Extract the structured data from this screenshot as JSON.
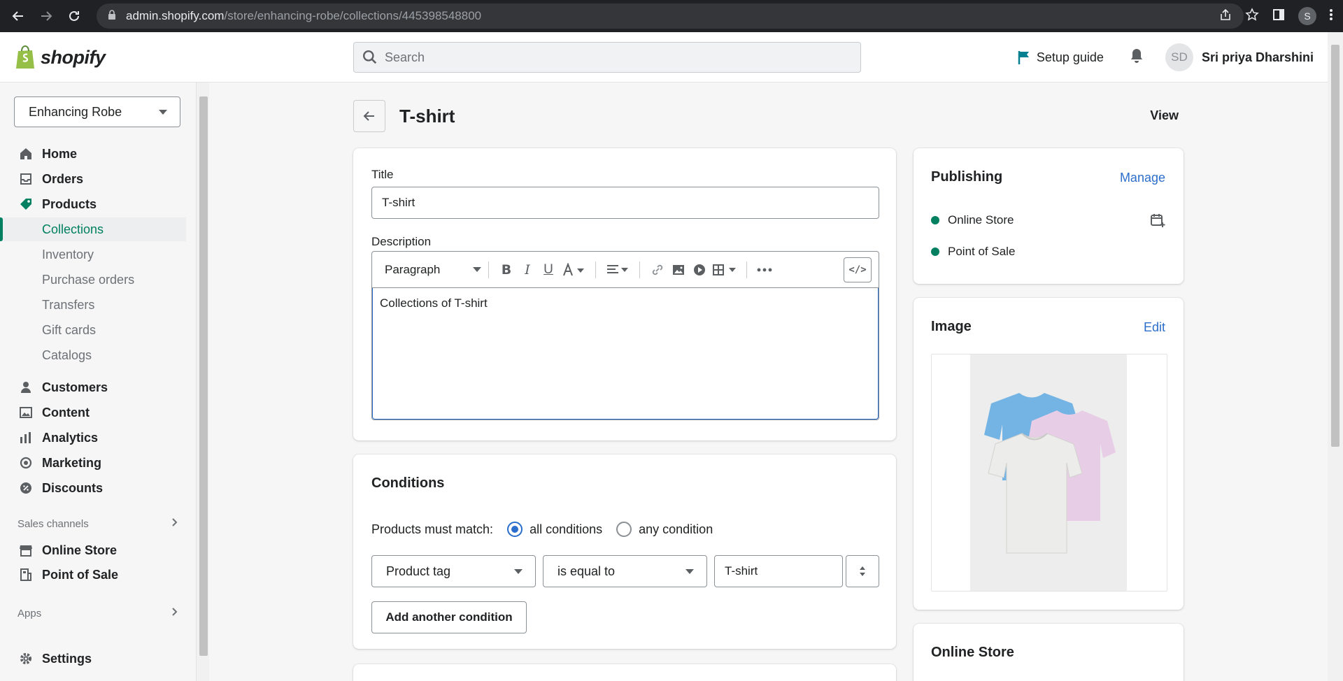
{
  "browser": {
    "url_host": "admin.shopify.com",
    "url_path": "/store/enhancing-robe/collections/445398548800",
    "profile_initial": "S"
  },
  "topbar": {
    "logo_text": "shopify",
    "search_placeholder": "Search",
    "setup_guide": "Setup guide",
    "avatar_initials": "SD",
    "user_name": "Sri priya Dharshini"
  },
  "sidebar": {
    "store_name": "Enhancing Robe",
    "items": [
      {
        "label": "Home",
        "icon": "home-icon"
      },
      {
        "label": "Orders",
        "icon": "inbox-icon"
      },
      {
        "label": "Products",
        "icon": "tag-icon"
      },
      {
        "label": "Collections"
      },
      {
        "label": "Inventory"
      },
      {
        "label": "Purchase orders"
      },
      {
        "label": "Transfers"
      },
      {
        "label": "Gift cards"
      },
      {
        "label": "Catalogs"
      },
      {
        "label": "Customers",
        "icon": "person-icon"
      },
      {
        "label": "Content",
        "icon": "image-icon"
      },
      {
        "label": "Analytics",
        "icon": "bar-chart-icon"
      },
      {
        "label": "Marketing",
        "icon": "target-icon"
      },
      {
        "label": "Discounts",
        "icon": "discount-icon"
      }
    ],
    "sales_channels_label": "Sales channels",
    "channels": [
      {
        "label": "Online Store",
        "icon": "store-icon"
      },
      {
        "label": "Point of Sale",
        "icon": "pos-icon"
      }
    ],
    "apps_label": "Apps",
    "settings_label": "Settings"
  },
  "page": {
    "title": "T-shirt",
    "view_label": "View"
  },
  "details": {
    "title_label": "Title",
    "title_value": "T-shirt",
    "description_label": "Description",
    "paragraph_label": "Paragraph",
    "description_value": "Collections of T-shirt",
    "html_toggle": "</>"
  },
  "conditions": {
    "heading": "Conditions",
    "match_label": "Products must match:",
    "all_label": "all conditions",
    "any_label": "any condition",
    "selected": "all",
    "field": "Product tag",
    "operator": "is equal to",
    "value": "T-shirt",
    "add_button": "Add another condition"
  },
  "publishing": {
    "heading": "Publishing",
    "manage": "Manage",
    "channels": [
      "Online Store",
      "Point of Sale"
    ]
  },
  "image_card": {
    "heading": "Image",
    "edit": "Edit"
  },
  "online_store_card": {
    "heading": "Online Store"
  },
  "colors": {
    "accent_green": "#008060",
    "link_blue": "#2c6ecb"
  }
}
